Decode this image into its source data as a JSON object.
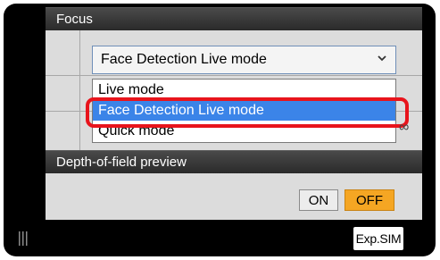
{
  "focus_section": {
    "header": "Focus",
    "selected_mode": "Face Detection Live mode",
    "options": [
      "Live mode",
      "Face Detection Live mode",
      "Quick mode"
    ],
    "highlighted_option": "Face Detection Live mode",
    "infinity_symbol": "∞"
  },
  "dof_section": {
    "header": "Depth-of-field preview",
    "on_label": "ON",
    "off_label": "OFF",
    "active": "OFF"
  },
  "footer": {
    "expsim_label": "Exp.SIM"
  },
  "colors": {
    "highlight_blue": "#3b84e8",
    "callout_red": "#e8141c",
    "off_active_orange": "#f5a623"
  },
  "icons": [
    "chevron-down-icon",
    "grip-icon"
  ]
}
